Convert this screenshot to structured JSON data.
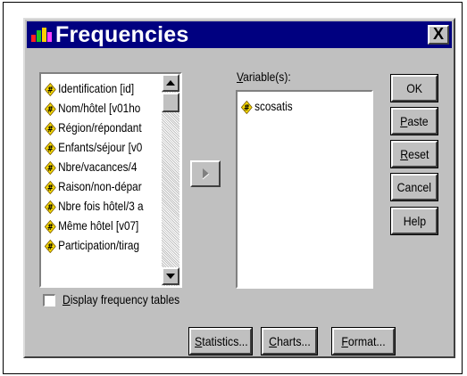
{
  "dialog": {
    "title": "Frequencies",
    "close_glyph": "X"
  },
  "source_list": {
    "items": [
      {
        "label": "Identification [id]",
        "icon": "scale-variable-icon"
      },
      {
        "label": "Nom/hôtel [v01ho",
        "icon": "scale-variable-icon"
      },
      {
        "label": "Région/répondant",
        "icon": "scale-variable-icon"
      },
      {
        "label": "Enfants/séjour [v0",
        "icon": "scale-variable-icon"
      },
      {
        "label": "Nbre/vacances/4",
        "icon": "scale-variable-icon"
      },
      {
        "label": "Raison/non-dépar",
        "icon": "scale-variable-icon"
      },
      {
        "label": "Nbre fois hôtel/3 a",
        "icon": "scale-variable-icon"
      },
      {
        "label": "Même hôtel [v07]",
        "icon": "scale-variable-icon"
      },
      {
        "label": "Participation/tirag",
        "icon": "scale-variable-icon"
      }
    ]
  },
  "target": {
    "label_first": "V",
    "label_rest": "ariable(s):",
    "items": [
      {
        "label": "scosatis",
        "icon": "scale-variable-icon"
      }
    ]
  },
  "move_button_icon": "right-arrow-icon",
  "buttons": {
    "ok": "OK",
    "paste_first": "P",
    "paste_rest": "aste",
    "reset_first": "R",
    "reset_rest": "eset",
    "cancel": "Cancel",
    "help": "Help"
  },
  "checkbox": {
    "first": "D",
    "rest": "isplay frequency tables",
    "checked": false
  },
  "bottom_buttons": {
    "statistics_first": "S",
    "statistics_rest": "tatistics...",
    "charts_first": "C",
    "charts_rest": "harts...",
    "format_first": "F",
    "format_rest": "ormat..."
  },
  "colors": {
    "titlebar": "#000080",
    "dialog_face": "#c0c0c0",
    "variable_icon": "#f5d800"
  }
}
